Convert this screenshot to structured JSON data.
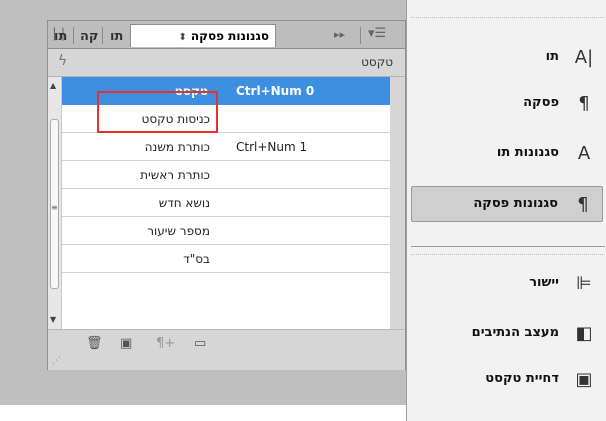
{
  "panel": {
    "tabs": [
      {
        "label": "סגנונות פסקה",
        "active": true
      },
      {
        "label": "תו"
      },
      {
        "label": "קה"
      },
      {
        "label": "תו"
      }
    ],
    "subheader_label": "טקסט",
    "styles": [
      {
        "name": "טקסט",
        "shortcut": "Ctrl+Num 0",
        "selected": true
      },
      {
        "name": "כניסות טקסט",
        "shortcut": ""
      },
      {
        "name": "כותרת משנה",
        "shortcut": "Ctrl+Num 1"
      },
      {
        "name": "כותרת ראשית",
        "shortcut": ""
      },
      {
        "name": "נושא חדש",
        "shortcut": ""
      },
      {
        "name": "מספר שיעור",
        "shortcut": ""
      },
      {
        "name": "בס\"ד",
        "shortcut": ""
      }
    ],
    "colors": {
      "selection": "#3d8fe0",
      "highlight_box": "#e8302d"
    }
  },
  "menu": {
    "items": [
      {
        "label": "תו",
        "icon": "character-A-icon"
      },
      {
        "label": "פסקה",
        "icon": "pilcrow-icon"
      },
      {
        "label": "סגנונות תו",
        "icon": "character-styles-icon"
      },
      {
        "label": "סגנונות פסקה",
        "icon": "paragraph-styles-icon",
        "active": true
      },
      {
        "label": "יישור",
        "icon": "align-icon"
      },
      {
        "label": "מעצב הנתיבים",
        "icon": "pathfinder-icon"
      },
      {
        "label": "דחיית טקסט",
        "icon": "text-wrap-icon"
      }
    ]
  }
}
